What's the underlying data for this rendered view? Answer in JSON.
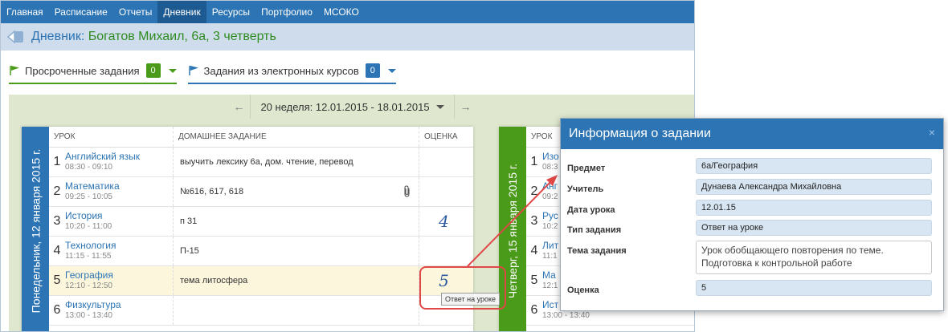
{
  "nav": {
    "items": [
      "Главная",
      "Расписание",
      "Отчеты",
      "Дневник",
      "Ресурсы",
      "Портфолио",
      "МСОКО"
    ],
    "active": "Дневник"
  },
  "header": {
    "title_prefix": "Дневник:",
    "title_student": "Богатов Михаил, 6а, 3 четверть"
  },
  "filters": {
    "overdue_label": "Просроченные задания",
    "overdue_count": "0",
    "courses_label": "Задания из электронных курсов",
    "courses_count": "0"
  },
  "week": {
    "label": "20 неделя: 12.01.2015 - 18.01.2015"
  },
  "monday": {
    "day_label": "Понедельник, 12 января 2015 г.",
    "headers": {
      "lesson": "УРОК",
      "hw": "ДОМАШНЕЕ ЗАДАНИЕ",
      "grade": "ОЦЕНКА"
    },
    "rows": [
      {
        "num": "1",
        "subject": "Английский язык",
        "time": "08:30 - 09:10",
        "hw": "выучить лексику 6а, дом. чтение, перевод",
        "grade": ""
      },
      {
        "num": "2",
        "subject": "Математика",
        "time": "09:25 - 10:05",
        "hw": "№616, 617, 618",
        "grade": ""
      },
      {
        "num": "3",
        "subject": "История",
        "time": "10:20 - 11:00",
        "hw": "п 31",
        "grade": "4"
      },
      {
        "num": "4",
        "subject": "Технология",
        "time": "11:15 - 11:55",
        "hw": "П-15",
        "grade": ""
      },
      {
        "num": "5",
        "subject": "География",
        "time": "12:10 - 12:50",
        "hw": "тема литосфера",
        "grade": "5"
      },
      {
        "num": "6",
        "subject": "Физкультура",
        "time": "13:00 - 13:40",
        "hw": "",
        "grade": ""
      }
    ]
  },
  "thursday": {
    "day_label": "Четверг, 15 января 2015 г.",
    "header_lesson": "УРОК",
    "rows": [
      {
        "num": "1",
        "subject": "Изо",
        "time": "08:3"
      },
      {
        "num": "2",
        "subject": "Анг",
        "time": "09:2"
      },
      {
        "num": "3",
        "subject": "Рус",
        "time": "10:2"
      },
      {
        "num": "4",
        "subject": "Лит",
        "time": "11:1"
      },
      {
        "num": "5",
        "subject": "Ма",
        "time": "12:1"
      },
      {
        "num": "6",
        "subject": "Ист",
        "time": "13:00 - 13:40"
      }
    ]
  },
  "tooltip": "Ответ на уроке",
  "modal": {
    "title": "Информация о задании",
    "close": "×",
    "fields": [
      {
        "label": "Предмет",
        "value": "6а/География"
      },
      {
        "label": "Учитель",
        "value": "Дунаева Александра Михайловна"
      },
      {
        "label": "Дата урока",
        "value": "12.01.15"
      },
      {
        "label": "Тип задания",
        "value": "Ответ на уроке"
      },
      {
        "label": "Тема задания",
        "value": "Урок обобщающего повторения по теме. Подготовка к контрольной работе"
      },
      {
        "label": "Оценка",
        "value": "5"
      }
    ]
  },
  "colors": {
    "primary": "#2c74b3",
    "green": "#4a9b1a",
    "annotation": "#e04848"
  }
}
